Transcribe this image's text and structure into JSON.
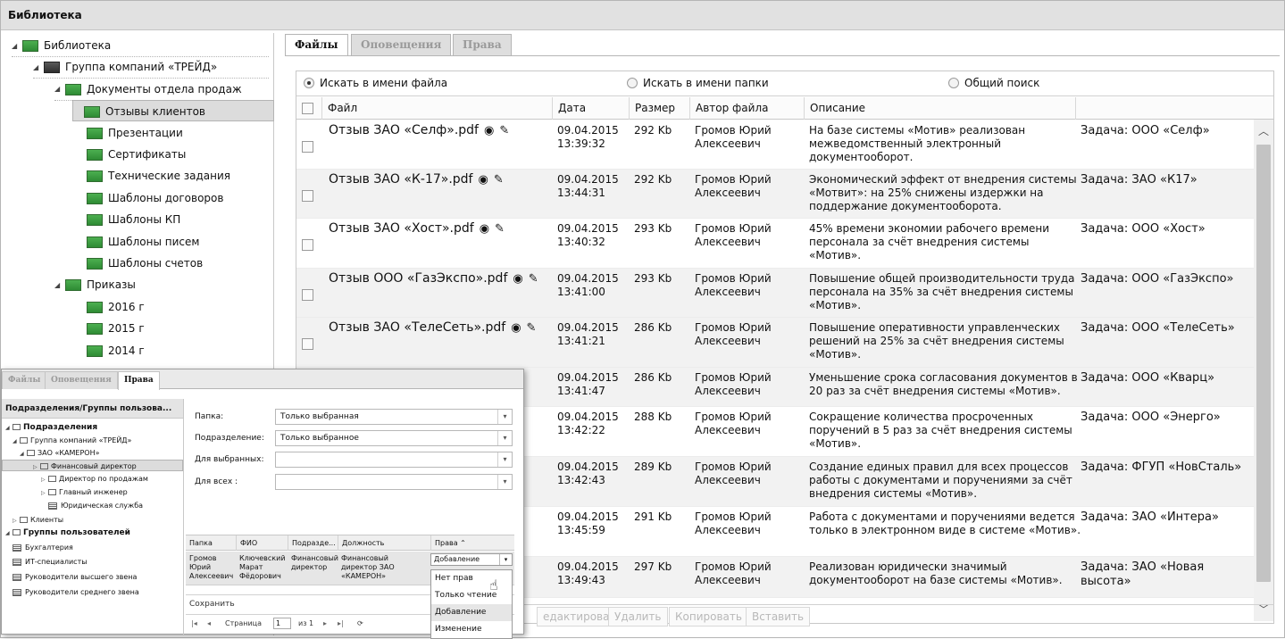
{
  "window": {
    "title": "Библиотека"
  },
  "tree": {
    "items": [
      {
        "label": "Библиотека",
        "level": 0,
        "expanded": true
      },
      {
        "label": "Группа компаний «ТРЕЙД»",
        "level": 1,
        "expanded": true,
        "dark": true
      },
      {
        "label": "Документы отдела продаж",
        "level": 2,
        "expanded": true
      },
      {
        "label": "Отзывы клиентов",
        "level": 3,
        "selected": true
      },
      {
        "label": "Презентации",
        "level": 3
      },
      {
        "label": "Сертификаты",
        "level": 3
      },
      {
        "label": "Технические задания",
        "level": 3
      },
      {
        "label": "Шаблоны договоров",
        "level": 3
      },
      {
        "label": "Шаблоны КП",
        "level": 3
      },
      {
        "label": "Шаблоны писем",
        "level": 3
      },
      {
        "label": "Шаблоны счетов",
        "level": 3
      },
      {
        "label": "Приказы",
        "level": 2,
        "expanded": true
      },
      {
        "label": "2016 г",
        "level": 3
      },
      {
        "label": "2015 г",
        "level": 3
      },
      {
        "label": "2014 г",
        "level": 3
      }
    ]
  },
  "tabs": [
    {
      "label": "Файлы",
      "active": true
    },
    {
      "label": "Оповещения",
      "active": false
    },
    {
      "label": "Права",
      "active": false
    }
  ],
  "search": {
    "options": [
      {
        "label": "Искать в имени файла",
        "selected": true
      },
      {
        "label": "Искать в имени папки",
        "selected": false
      },
      {
        "label": "Общий поиск",
        "selected": false
      }
    ]
  },
  "grid": {
    "columns": [
      "Файл",
      "Дата",
      "Размер",
      "Автор файла",
      "Описание"
    ],
    "rows": [
      {
        "file": "Отзыв ЗАО «Селф».pdf",
        "date": "09.04.2015",
        "time": "13:39:32",
        "size": "292 Kb",
        "author1": "Громов Юрий",
        "author2": "Алексеевич",
        "desc": [
          "На базе системы «Мотив» реализован",
          "межведомственный электронный",
          "документооборот."
        ],
        "task": "Задача: ООО «Селф»"
      },
      {
        "file": "Отзыв ЗАО «К-17».pdf",
        "date": "09.04.2015",
        "time": "13:44:31",
        "size": "292 Kb",
        "author1": "Громов Юрий",
        "author2": "Алексеевич",
        "desc": [
          "Экономический эффект от внедрения системы",
          "«Мотвит»: на 25% снижены издержки на",
          "поддержание документооборота."
        ],
        "task": "Задача: ЗАО «К17»"
      },
      {
        "file": "Отзыв ЗАО «Хост».pdf",
        "date": "09.04.2015",
        "time": "13:40:32",
        "size": "293 Kb",
        "author1": "Громов Юрий",
        "author2": "Алексеевич",
        "desc": [
          "45% времени экономии рабочего времени",
          "персонала за счёт внедрения системы",
          "«Мотив»."
        ],
        "task": "Задача: ООО «Хост»"
      },
      {
        "file": "Отзыв ООО «ГазЭкспо».pdf",
        "date": "09.04.2015",
        "time": "13:41:00",
        "size": "293 Kb",
        "author1": "Громов Юрий",
        "author2": "Алексеевич",
        "desc": [
          "Повышение общей производительности труда",
          "персонала на 35% за счёт внедрения системы",
          "«Мотив»."
        ],
        "task": "Задача: ООО «ГазЭкспо»"
      },
      {
        "file": "Отзыв ЗАО «ТелеСеть».pdf",
        "date": "09.04.2015",
        "time": "13:41:21",
        "size": "286 Kb",
        "author1": "Громов Юрий",
        "author2": "Алексеевич",
        "desc": [
          "Повышение оперативности управленческих",
          "решений на 25% за счёт внедрения системы",
          "«Мотив»."
        ],
        "task": "Задача: ООО «ТелеСеть»"
      },
      {
        "file": "",
        "date": "09.04.2015",
        "time": "13:41:47",
        "size": "286 Kb",
        "author1": "Громов Юрий",
        "author2": "Алексеевич",
        "desc": [
          "Уменьшение срока согласования документов в",
          "20 раз за счёт внедрения системы «Мотив»."
        ],
        "task": "Задача: ООО «Кварц»"
      },
      {
        "file": "",
        "date": "09.04.2015",
        "time": "13:42:22",
        "size": "288 Kb",
        "author1": "Громов Юрий",
        "author2": "Алексеевич",
        "desc": [
          "Сокращение количества просроченных",
          "поручений в 5 раз за счёт внедрения системы",
          "«Мотив»."
        ],
        "task": "Задача: ООО «Энерго»"
      },
      {
        "file": "",
        "date": "09.04.2015",
        "time": "13:42:43",
        "size": "289 Kb",
        "author1": "Громов Юрий",
        "author2": "Алексеевич",
        "desc": [
          "Создание единых правил для всех процессов",
          "работы с документами и поручениями за счёт",
          "внедрения системы «Мотив»."
        ],
        "task": "Задача: ФГУП «НовСталь»"
      },
      {
        "file": "",
        "date": "09.04.2015",
        "time": "13:45:59",
        "size": "291 Kb",
        "author1": "Громов Юрий",
        "author2": "Алексеевич",
        "desc": [
          "Работа с документами и поручениями ведется",
          "только в электронном виде в системе «Мотив»."
        ],
        "task": "Задача: ЗАО «Интера»"
      },
      {
        "file": "",
        "date": "09.04.2015",
        "time": "13:49:43",
        "size": "297 Kb",
        "author1": "Громов Юрий",
        "author2": "Алексеевич",
        "desc": [
          "Реализован юридически значимый",
          "документооборот на базе системы «Мотив»."
        ],
        "task": "Задача: ЗАО «Новая",
        "task2": "высота»"
      }
    ]
  },
  "toolbar": {
    "buttons": [
      "едактировать",
      "Удалить",
      "Копировать",
      "Вставить"
    ]
  },
  "overlay": {
    "tabs": [
      {
        "label": "Файлы",
        "active": false
      },
      {
        "label": "Оповещения",
        "active": false
      },
      {
        "label": "Права",
        "active": true
      }
    ],
    "left_header": "Подразделения/Группы пользова...",
    "tree": [
      {
        "label": "Подразделения",
        "bold": true
      },
      {
        "label": "Группа компаний «ТРЕЙД»"
      },
      {
        "label": "ЗАО «КАМЕРОН»"
      },
      {
        "label": "Финансовый директор",
        "selected": true
      },
      {
        "label": "Директор по продажам"
      },
      {
        "label": "Главный инженер"
      },
      {
        "label": "Юридическая служба"
      },
      {
        "label": "Клиенты"
      },
      {
        "label": "Группы пользователей",
        "bold": true
      },
      {
        "label": "Бухгалтерия"
      },
      {
        "label": "ИТ-специалисты"
      },
      {
        "label": "Руководители высшего звена"
      },
      {
        "label": "Руководители среднего звена"
      }
    ],
    "form": {
      "folder_label": "Папка:",
      "folder_value": "Только выбранная",
      "dept_label": "Подразделение:",
      "dept_value": "Только выбранное",
      "selected_label": "Для выбранных:",
      "all_label": "Для всех :"
    },
    "grid_head": [
      "Папка",
      "ФИО",
      "Подразде...",
      "Должность",
      "Права ⌃"
    ],
    "grid_row": {
      "folder": [
        "Громов",
        "Юрий",
        "Алексеевич"
      ],
      "fio": [
        "Ключевский",
        "Марат",
        "Фёдорович"
      ],
      "dept": [
        "Финансовый",
        "директор"
      ],
      "position": [
        "Финансовый",
        "директор ЗАО",
        "«КАМЕРОН»"
      ],
      "rights": "Добавление"
    },
    "dropdown": [
      "Нет прав",
      "Только чтение",
      "Добавление",
      "Изменение"
    ],
    "save_label": "Сохранить",
    "pager": {
      "page_label": "Страница",
      "page": "1",
      "of": "из 1"
    }
  }
}
